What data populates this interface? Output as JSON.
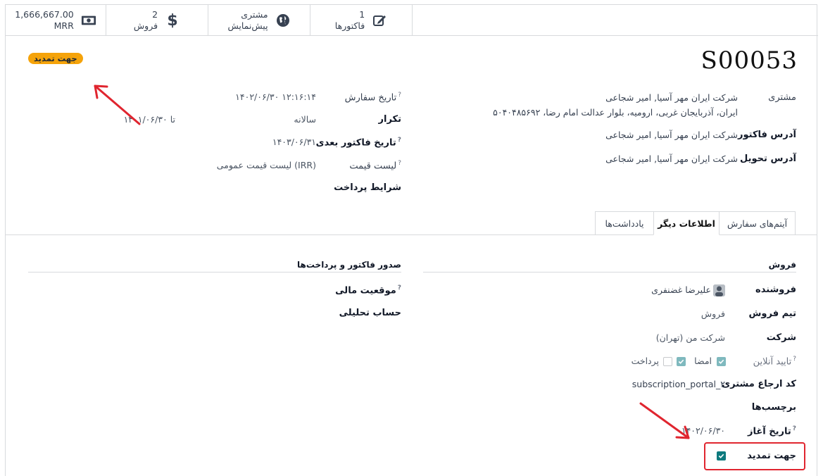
{
  "smart_buttons": [
    {
      "value": "1,666,667.00",
      "label": "MRR",
      "icon": "money-icon"
    },
    {
      "value": "2",
      "label": "فروش",
      "icon": "dollar-icon"
    },
    {
      "value": "مشتری",
      "label": "پیش‌نمایش",
      "icon": "globe-icon"
    },
    {
      "value": "1",
      "label": "فاکتورها",
      "icon": "edit-icon"
    }
  ],
  "record": {
    "name": "S00053",
    "stage_badge": "جهت تمدید"
  },
  "left_fields": {
    "order_date_label": "تاریخ سفارش",
    "order_date_value": "۱۴۰۲/۰۶/۳۰ ۱۲:۱۶:۱۴",
    "recurrence_label": "تکرار",
    "recurrence_value": "سالانه",
    "recurrence_until": "تا ۱۴۰۱/۰۶/۳۰",
    "next_invoice_label": "تاریخ فاکتور بعدی",
    "next_invoice_value": "۱۴۰۳/۰۶/۳۱",
    "pricelist_label": "لیست قیمت",
    "pricelist_value": "لیست قیمت عمومی (IRR)",
    "payment_terms_label": "شرایط پرداخت"
  },
  "right_fields": {
    "customer_label": "مشتری",
    "customer_line1": "شرکت ایران مهر آسیا, امیر شجاعی",
    "customer_line2": "ایران، آذربایجان غربی، ارومیه، بلوار عدالت امام رضا، ۵۰۴۰۴۸۵۶۹۲",
    "invoice_address_label": "آدرس فاکتور",
    "invoice_address_value": "شرکت ایران مهر آسیا, امیر شجاعی",
    "delivery_address_label": "آدرس تحویل",
    "delivery_address_value": "شرکت ایران مهر آسیا, امیر شجاعی"
  },
  "tabs": [
    "آیتم‌های سفارش",
    "اطلاعات دیگر",
    "یادداشت‌ها"
  ],
  "active_tab": "اطلاعات دیگر",
  "sales_section": {
    "title": "فروش",
    "salesperson_label": "فروشنده",
    "salesperson_value": "علیرضا غضنفری",
    "team_label": "تیم فروش",
    "team_value": "فروش",
    "company_label": "شرکت",
    "company_value": "شرکت من (تهران)",
    "online_label": "تایید آنلاین",
    "online_sign": "امضا",
    "online_sign_checked": true,
    "online_pay": "پرداخت",
    "online_pay_checked": false,
    "ref_label": "کد ارجاع مشتری",
    "ref_value": "subscription_portal_۲",
    "tags_label": "برچسب‌ها",
    "start_label": "تاریخ آغاز",
    "start_value": "۱۴۰۲/۰۶/۳۰",
    "renew_label": "جهت تمدید",
    "renew_checked": true
  },
  "invoicing_section": {
    "title": "صدور فاکتور و پرداخت‌ها",
    "fiscal_label": "موقعیت مالی",
    "analytic_label": "حساب تحلیلی"
  },
  "colors": {
    "badge": "#f5a30a",
    "annotation_red": "#e0252f",
    "checkbox": "#0e7a7e"
  }
}
